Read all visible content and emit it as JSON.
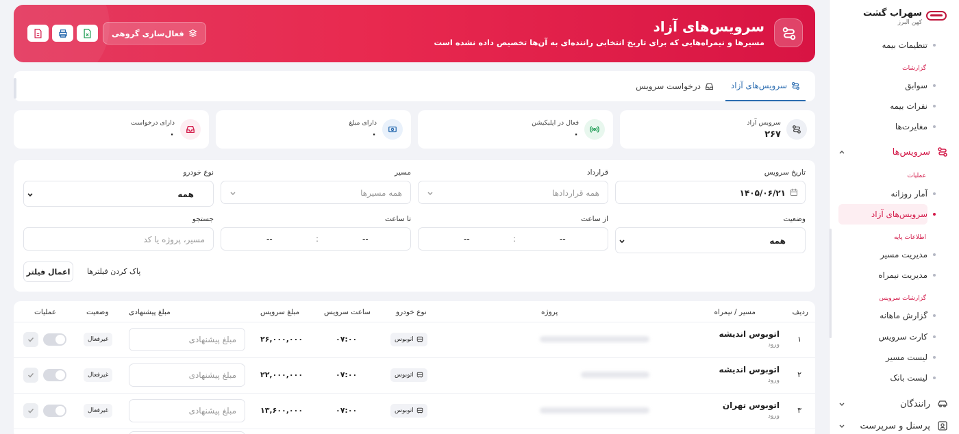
{
  "sidebar": {
    "brand_name": "سهراب گشت",
    "brand_sub": "کهن البرز",
    "items": [
      {
        "label": "تنظیمات بیمه"
      },
      {
        "label": "سوابق"
      },
      {
        "label": "نفرات بیمه"
      },
      {
        "label": "مغایرت‌ها"
      },
      {
        "label": "آمار روزانه"
      },
      {
        "label": "سرویس‌های آزاد"
      },
      {
        "label": "مدیریت مسیر"
      },
      {
        "label": "مدیریت نیمراه"
      },
      {
        "label": "گزارش ماهانه"
      },
      {
        "label": "کارت سرویس"
      },
      {
        "label": "لیست مسیر"
      },
      {
        "label": "لیست بانک"
      }
    ],
    "headings": {
      "reports": "گزارشات",
      "operations": "عملیات",
      "basic_info": "اطلاعات پایه",
      "service_reports": "گزارشات سرویس"
    },
    "groups": {
      "services": "سرویس‌ها",
      "drivers": "رانندگان",
      "personnel": "پرسنل و سرپرست"
    }
  },
  "header": {
    "title": "سرویس‌های آزاد",
    "subtitle": "مسیرها و نیمراه‌هایی که برای تاریخ انتخابی راننده‌ای به آن‌ها تخصیص داده نشده است",
    "group_activate_label": "فعال‌سازی گروهی"
  },
  "tabs": {
    "free_services": "سرویس‌های آزاد",
    "service_request": "درخواست سرویس"
  },
  "stats": [
    {
      "label": "سرویس آزاد",
      "value": "۲۶۷"
    },
    {
      "label": "فعال در اپلیکیشن",
      "value": "۰"
    },
    {
      "label": "دارای مبلغ",
      "value": "۰"
    },
    {
      "label": "دارای درخواست",
      "value": "۰"
    }
  ],
  "filters": {
    "service_date_label": "تاریخ سرویس",
    "service_date_value": "۱۴۰۵/۰۶/۲۱",
    "contract_label": "قرارداد",
    "contract_placeholder": "همه قراردادها",
    "route_label": "مسیر",
    "route_placeholder": "همه مسیرها",
    "vehicle_label": "نوع خودرو",
    "vehicle_value": "همه",
    "status_label": "وضعیت",
    "status_value": "همه",
    "from_time_label": "از ساعت",
    "to_time_label": "تا ساعت",
    "time_dash": "--",
    "time_sep": ":",
    "search_label": "جستجو",
    "search_placeholder": "مسیر، پروژه یا کد",
    "clear_label": "پاک کردن فیلترها",
    "apply_label": "اعمال فیلتر"
  },
  "table": {
    "headers": {
      "row": "ردیف",
      "route": "مسیر / نیمراه",
      "project": "پروژه",
      "vehicle": "نوع خودرو",
      "time": "ساعت سرویس",
      "price": "مبلغ سرویس",
      "offer": "مبلغ پیشنهادی",
      "status": "وضعیت",
      "ops": "عملیات"
    },
    "offer_placeholder": "مبلغ پیشنهادی",
    "rows": [
      {
        "index": "۱",
        "route": "اتوبوس اندیشه",
        "direction": "ورود",
        "vehicle": "اتوبوس",
        "time": "۰۷:۰۰",
        "price": "۲۶,۰۰۰,۰۰۰",
        "status": "غیرفعال"
      },
      {
        "index": "۲",
        "route": "اتوبوس اندیشه",
        "direction": "ورود",
        "vehicle": "اتوبوس",
        "time": "۰۷:۰۰",
        "price": "۲۲,۰۰۰,۰۰۰",
        "status": "غیرفعال"
      },
      {
        "index": "۳",
        "route": "اتوبوس تهران",
        "direction": "ورود",
        "vehicle": "اتوبوس",
        "time": "۰۷:۰۰",
        "price": "۱۳,۶۰۰,۰۰۰",
        "status": "غیرفعال"
      }
    ]
  },
  "colors": {
    "brand": "#e8294f",
    "accent": "#2b6cb0",
    "active_bg": "#fdeef2"
  }
}
